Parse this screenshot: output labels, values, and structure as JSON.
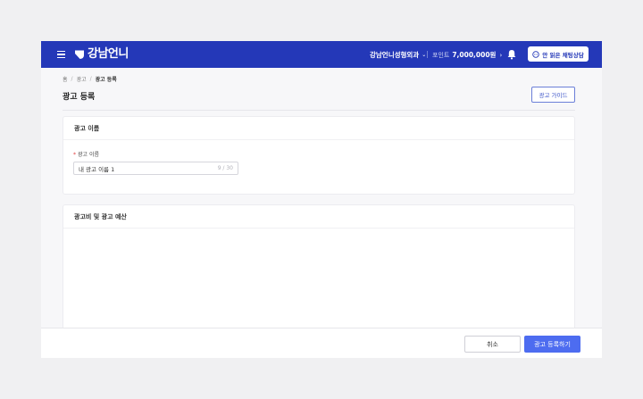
{
  "header": {
    "logo_text": "강남언니",
    "clinic_name": "강남언니성형외과",
    "points_label": "포인트",
    "points_value": "7,000,000원",
    "chat_button": "안 읽은 채팅상담"
  },
  "breadcrumb": {
    "items": [
      "홈",
      "광고",
      "광고 등록"
    ]
  },
  "page": {
    "title": "광고 등록",
    "guide_button": "광고 가이드"
  },
  "ad_name_section": {
    "title": "광고 이름",
    "field_required_mark": "*",
    "field_label": "광고 이름",
    "input_value": "내 광고 이름 1",
    "char_count": "9 / 30"
  },
  "budget_section": {
    "title": "광고비 및 광고 예산"
  },
  "footer": {
    "cancel_label": "취소",
    "submit_label": "광고 등록하기"
  },
  "colors": {
    "header_bg": "#2438b8",
    "primary": "#4d6cf0",
    "required": "#e03c3c"
  }
}
